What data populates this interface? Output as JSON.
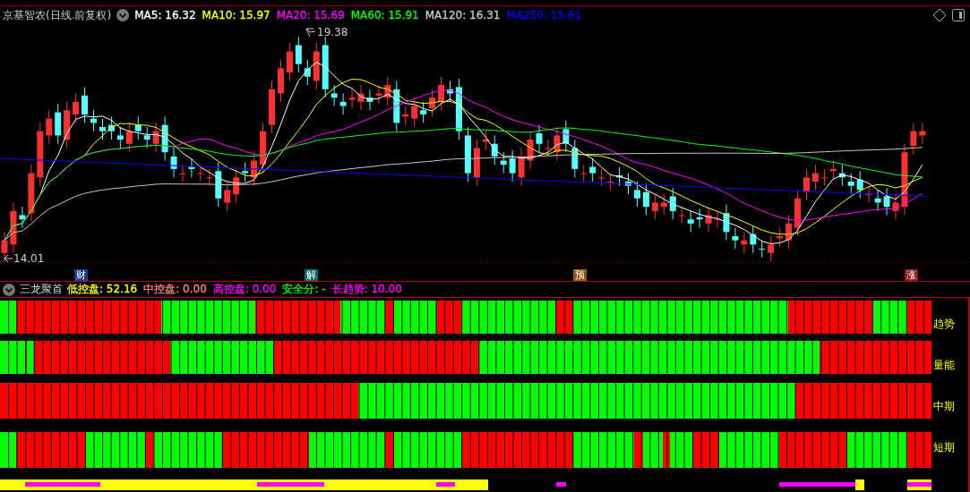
{
  "chart": {
    "title": "京基智农(日线.前复权)",
    "moving_averages": [
      {
        "label": "MA5: 16.32",
        "color": "#ffffff"
      },
      {
        "label": "MA10: 15.97",
        "color": "#ffff00"
      },
      {
        "label": "MA20: 15.69",
        "color": "#ff00ff"
      },
      {
        "label": "MA60: 15.91",
        "color": "#00ff00"
      },
      {
        "label": "MA120: 16.31",
        "color": "#c8c8c8"
      },
      {
        "label": "MA250: 15.61",
        "color": "#0000ff"
      }
    ],
    "high_label": "19.38",
    "low_label": "14.01",
    "events": [
      {
        "label": "财",
        "color": "#1c3c8c"
      },
      {
        "label": "解",
        "color": "#0e6e6e"
      },
      {
        "label": "预",
        "color": "#8c5a00"
      },
      {
        "label": "涨",
        "color": "#8c1c1c"
      }
    ]
  },
  "indicator": {
    "name": "三龙聚首",
    "values": [
      {
        "label": "低控盘: 52.16",
        "color": "#ffff00"
      },
      {
        "label": "中控盘: 0.00",
        "color": "#ff8080"
      },
      {
        "label": "高控盘: 0.00",
        "color": "#ff00ff"
      },
      {
        "label": "安全分: -",
        "color": "#00ff00"
      },
      {
        "label": "长趋势: 10.00",
        "color": "#ff00ff"
      }
    ],
    "rows": [
      {
        "label": "趋势"
      },
      {
        "label": "量能"
      },
      {
        "label": "中期"
      },
      {
        "label": "短期"
      }
    ]
  }
}
